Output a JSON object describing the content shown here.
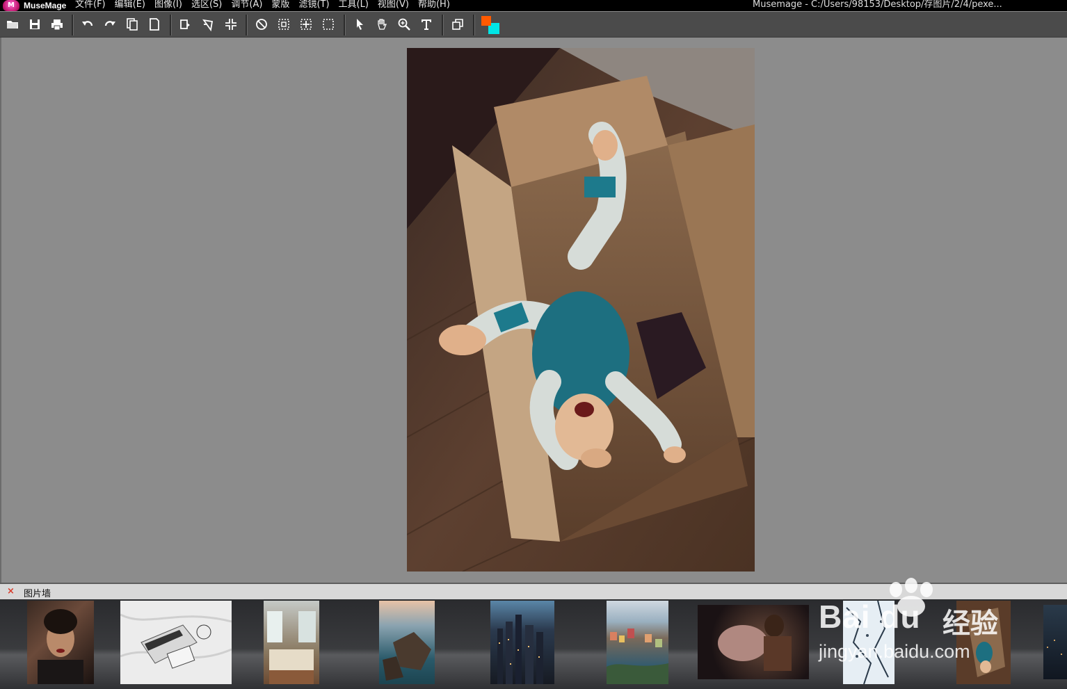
{
  "app": {
    "logo_text": "MuseMage",
    "logo_mark": "M",
    "window_title": "Musemage - C:/Users/98153/Desktop/存图片/2/4/pexe..."
  },
  "menu": {
    "items": [
      {
        "label": "文件(F)"
      },
      {
        "label": "编辑(E)"
      },
      {
        "label": "图像(I)"
      },
      {
        "label": "选区(S)"
      },
      {
        "label": "调节(A)"
      },
      {
        "label": "蒙版"
      },
      {
        "label": "滤镜(T)"
      },
      {
        "label": "工具(L)"
      },
      {
        "label": "视图(V)"
      },
      {
        "label": "帮助(H)"
      }
    ]
  },
  "toolbar": {
    "buttons": [
      {
        "icon": "open-folder-icon"
      },
      {
        "icon": "save-icon"
      },
      {
        "icon": "print-icon"
      },
      {
        "icon": "undo-icon"
      },
      {
        "icon": "redo-icon"
      },
      {
        "icon": "copy-icon"
      },
      {
        "icon": "paste-icon"
      },
      {
        "icon": "rotate-icon"
      },
      {
        "icon": "flip-icon"
      },
      {
        "icon": "crop-icon"
      },
      {
        "icon": "deselect-icon"
      },
      {
        "icon": "select-all-icon"
      },
      {
        "icon": "select-inverse-icon"
      },
      {
        "icon": "marquee-icon"
      },
      {
        "icon": "pointer-icon"
      },
      {
        "icon": "hand-icon"
      },
      {
        "icon": "zoom-icon"
      },
      {
        "icon": "text-icon"
      },
      {
        "icon": "layers-icon"
      }
    ],
    "foreground_color": "#ff5a00",
    "background_color": "#00e5e5"
  },
  "panel": {
    "close_glyph": "×",
    "title": "图片墙"
  },
  "thumbnails": [
    {
      "name": "portrait-woman"
    },
    {
      "name": "laptop-on-sheets"
    },
    {
      "name": "bedroom-interior"
    },
    {
      "name": "coastal-rocks"
    },
    {
      "name": "city-night-skyline"
    },
    {
      "name": "coastal-village"
    },
    {
      "name": "boxer-punch"
    },
    {
      "name": "snowy-aerial"
    },
    {
      "name": "baby-in-box"
    },
    {
      "name": "city-night-dark"
    }
  ],
  "watermark": {
    "brand": "Bai du",
    "cn": "经验",
    "url": "jingyan.baidu.com"
  }
}
